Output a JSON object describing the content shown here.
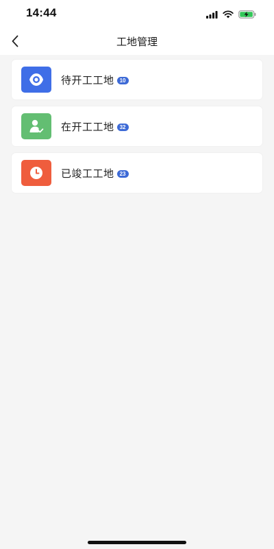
{
  "status_bar": {
    "time": "14:44",
    "icons": [
      "signal-icon",
      "wifi-icon",
      "battery-charging-icon"
    ]
  },
  "nav": {
    "back_icon": "chevron-left-icon",
    "title": "工地管理"
  },
  "sites": [
    {
      "label": "待开工工地",
      "count": "10",
      "icon": "location-target-icon",
      "color": "#3f6ee7"
    },
    {
      "label": "在开工工地",
      "count": "32",
      "icon": "user-check-icon",
      "color": "#63be72"
    },
    {
      "label": "已竣工工地",
      "count": "23",
      "icon": "clock-icon",
      "color": "#ef5d3d"
    }
  ],
  "colors": {
    "badge": "#3d6ad6",
    "background": "#f5f5f5",
    "card": "#ffffff"
  }
}
